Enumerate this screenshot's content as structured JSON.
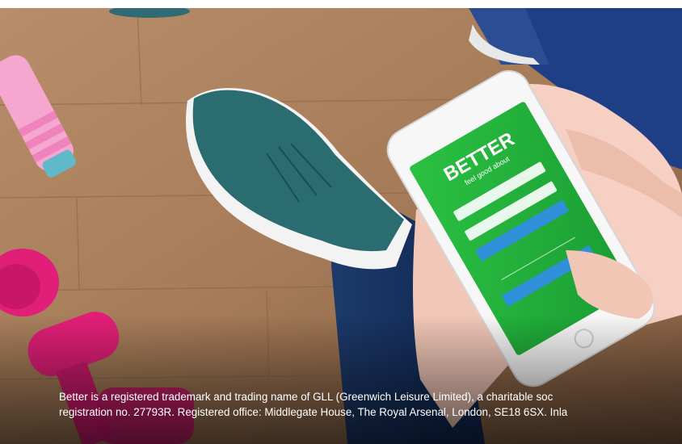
{
  "phone_app": {
    "logo_text": "BETTER",
    "tagline": "feel good about"
  },
  "footer": {
    "legal_line_1": "Better is a registered trademark and trading name of GLL (Greenwich Leisure Limited), a charitable soc",
    "legal_line_2": "registration no. 27793R. Registered office: Middlegate House, The Royal Arsenal, London, SE18 6SX. Inla"
  },
  "colors": {
    "app_green": "#21b23b",
    "app_blue_button": "#2f8fd8",
    "wood_floor": "#a9805f",
    "text_white": "#ffffff"
  }
}
